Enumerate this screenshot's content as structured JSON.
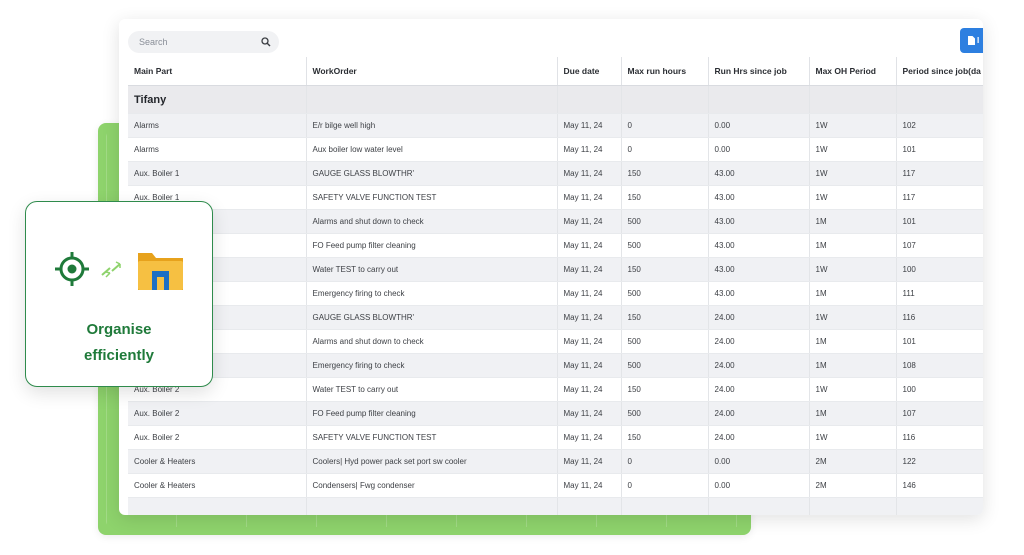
{
  "search": {
    "placeholder": "Search"
  },
  "toolbar": {
    "export_label": "I"
  },
  "table": {
    "headers": [
      "Main Part",
      "WorkOrder",
      "Due date",
      "Max run hours",
      "Run Hrs since job",
      "Max OH Period",
      "Period since job(da"
    ],
    "group": "Tifany",
    "rows": [
      [
        "Alarms",
        "E/r bilge well high",
        "May 11, 24",
        "0",
        "0.00",
        "1W",
        "102"
      ],
      [
        "Alarms",
        "Aux boiler low water level",
        "May 11, 24",
        "0",
        "0.00",
        "1W",
        "101"
      ],
      [
        "Aux. Boiler 1",
        "GAUGE GLASS BLOWTHR'",
        "May 11, 24",
        "150",
        "43.00",
        "1W",
        "117"
      ],
      [
        "Aux. Boiler 1",
        "SAFETY VALVE FUNCTION TEST",
        "May 11, 24",
        "150",
        "43.00",
        "1W",
        "117"
      ],
      [
        "",
        "Alarms and shut down to check",
        "May 11, 24",
        "500",
        "43.00",
        "1M",
        "101"
      ],
      [
        "",
        "FO Feed pump filter cleaning",
        "May 11, 24",
        "500",
        "43.00",
        "1M",
        "107"
      ],
      [
        "",
        "Water TEST to carry out",
        "May 11, 24",
        "150",
        "43.00",
        "1W",
        "100"
      ],
      [
        "",
        "Emergency firing to check",
        "May 11, 24",
        "500",
        "43.00",
        "1M",
        "111"
      ],
      [
        "",
        "GAUGE GLASS BLOWTHR'",
        "May 11, 24",
        "150",
        "24.00",
        "1W",
        "116"
      ],
      [
        "",
        "Alarms and shut down to check",
        "May 11, 24",
        "500",
        "24.00",
        "1M",
        "101"
      ],
      [
        "",
        "Emergency firing to check",
        "May 11, 24",
        "500",
        "24.00",
        "1M",
        "108"
      ],
      [
        "Aux. Boiler 2",
        "Water TEST to carry out",
        "May 11, 24",
        "150",
        "24.00",
        "1W",
        "100"
      ],
      [
        "Aux. Boiler 2",
        "FO Feed pump filter cleaning",
        "May 11, 24",
        "500",
        "24.00",
        "1M",
        "107"
      ],
      [
        "Aux. Boiler 2",
        "SAFETY VALVE FUNCTION TEST",
        "May 11, 24",
        "150",
        "24.00",
        "1W",
        "116"
      ],
      [
        "Cooler & Heaters",
        "Coolers| Hyd power pack set port sw cooler",
        "May 11, 24",
        "0",
        "0.00",
        "2M",
        "122"
      ],
      [
        "Cooler & Heaters",
        "Condensers| Fwg condenser",
        "May 11, 24",
        "0",
        "0.00",
        "2M",
        "146"
      ],
      [
        "",
        "",
        "",
        "",
        "",
        "",
        ""
      ]
    ]
  },
  "card": {
    "line1": "Organise",
    "line2": "efficiently"
  },
  "colors": {
    "accent_green": "#1f7a3a",
    "button_blue": "#2d7fe0",
    "folder_yellow": "#f6c042"
  }
}
